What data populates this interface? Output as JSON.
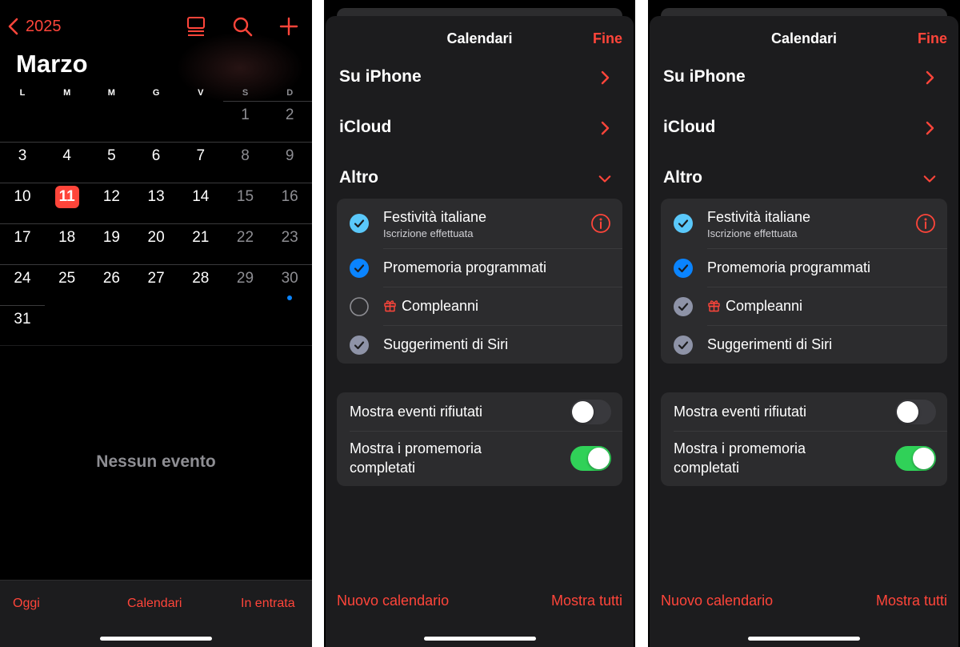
{
  "calendar_view": {
    "back_label": "2025",
    "month_title": "Marzo",
    "weekdays": [
      "L",
      "M",
      "M",
      "G",
      "V",
      "S",
      "D"
    ],
    "weeks": [
      [
        "",
        "",
        "",
        "",
        "",
        "1",
        "2"
      ],
      [
        "3",
        "4",
        "5",
        "6",
        "7",
        "8",
        "9"
      ],
      [
        "10",
        "11",
        "12",
        "13",
        "14",
        "15",
        "16"
      ],
      [
        "17",
        "18",
        "19",
        "20",
        "21",
        "22",
        "23"
      ],
      [
        "24",
        "25",
        "26",
        "27",
        "28",
        "29",
        "30"
      ],
      [
        "31",
        "",
        "",
        "",
        "",
        "",
        ""
      ]
    ],
    "today": "11",
    "event_day": "30",
    "no_events": "Nessun evento",
    "toolbar": {
      "today": "Oggi",
      "calendars": "Calendari",
      "inbox": "In entrata"
    },
    "icons": [
      "chevron-left-icon",
      "list-view-icon",
      "search-icon",
      "plus-icon"
    ]
  },
  "sheets": [
    {
      "title": "Calendari",
      "done": "Fine",
      "sections": {
        "iphone": "Su iPhone",
        "icloud": "iCloud",
        "other": "Altro"
      },
      "other_calendars": [
        {
          "name": "Festività italiane",
          "subtitle": "Iscrizione effettuata",
          "state": "checked",
          "color": "#5ac8fa"
        },
        {
          "name": "Promemoria programmati",
          "state": "checked",
          "color": "#0a84ff"
        },
        {
          "name": "Compleanni",
          "state": "unchecked",
          "color": "#8e8e93"
        },
        {
          "name": "Suggerimenti di Siri",
          "state": "checked",
          "color": "#8e93a7"
        }
      ],
      "settings": {
        "declined": {
          "label": "Mostra eventi rifiutati",
          "on": false
        },
        "completed": {
          "label": "Mostra i promemoria completati",
          "on": true
        }
      },
      "footer": {
        "new_calendar": "Nuovo calendario",
        "show_all": "Mostra tutti"
      }
    },
    {
      "title": "Calendari",
      "done": "Fine",
      "sections": {
        "iphone": "Su iPhone",
        "icloud": "iCloud",
        "other": "Altro"
      },
      "other_calendars": [
        {
          "name": "Festività italiane",
          "subtitle": "Iscrizione effettuata",
          "state": "checked",
          "color": "#5ac8fa"
        },
        {
          "name": "Promemoria programmati",
          "state": "checked",
          "color": "#0a84ff"
        },
        {
          "name": "Compleanni",
          "state": "checked",
          "color": "#8e93a7"
        },
        {
          "name": "Suggerimenti di Siri",
          "state": "checked",
          "color": "#8e93a7"
        }
      ],
      "settings": {
        "declined": {
          "label": "Mostra eventi rifiutati",
          "on": false
        },
        "completed": {
          "label": "Mostra i promemoria completati",
          "on": true
        }
      },
      "footer": {
        "new_calendar": "Nuovo calendario",
        "show_all": "Mostra tutti"
      }
    }
  ],
  "colors": {
    "accent": "#ff453a",
    "toggle_on": "#30d158",
    "event_dot": "#0a84ff"
  }
}
